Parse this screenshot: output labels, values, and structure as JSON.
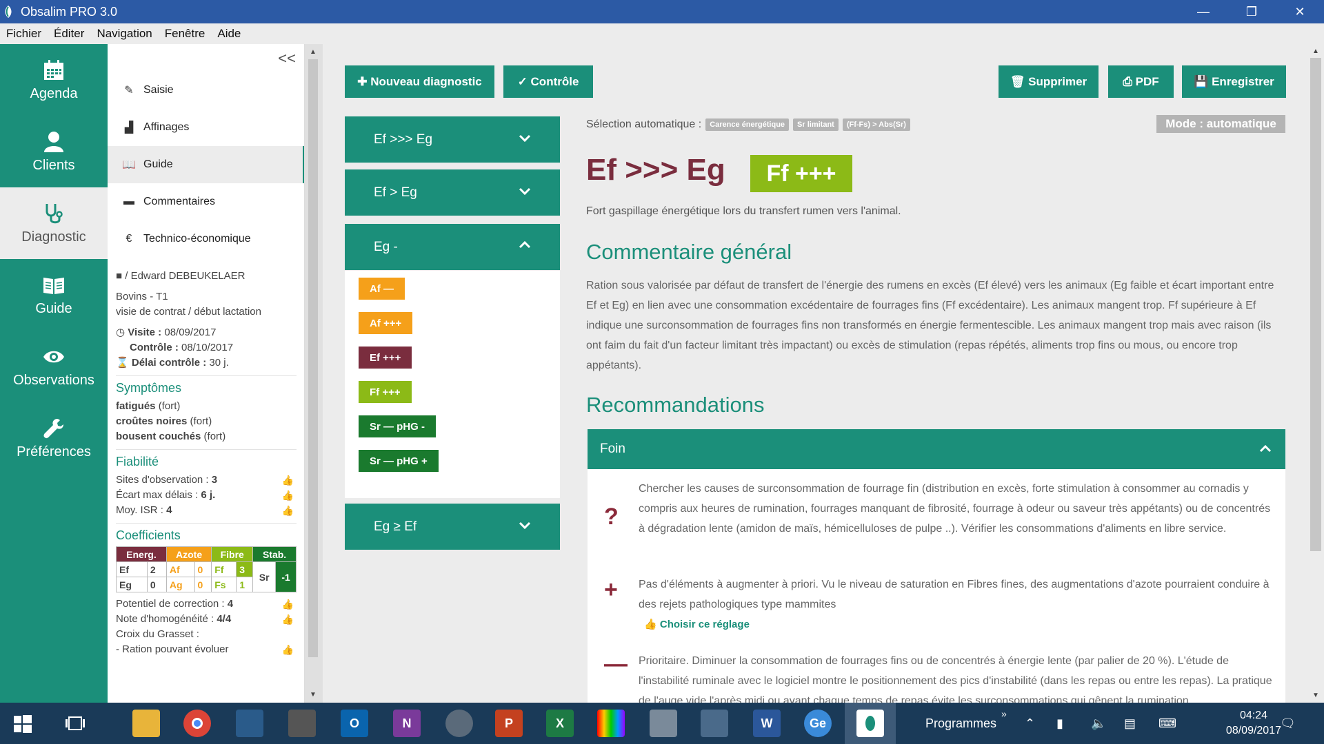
{
  "window": {
    "title": "Obsalim PRO 3.0",
    "minimize": "—",
    "restore": "❐",
    "close": "✕"
  },
  "menu": [
    "Fichier",
    "Éditer",
    "Navigation",
    "Fenêtre",
    "Aide"
  ],
  "mainnav": [
    {
      "label": "Agenda",
      "icon": "calendar-icon"
    },
    {
      "label": "Clients",
      "icon": "user-icon"
    },
    {
      "label": "Diagnostic",
      "icon": "stethoscope-icon",
      "active": true
    },
    {
      "label": "Guide",
      "icon": "book-icon"
    },
    {
      "label": "Observations",
      "icon": "eye-icon"
    },
    {
      "label": "Préférences",
      "icon": "wrench-icon"
    }
  ],
  "subnav": {
    "collapse": "<<",
    "items": [
      {
        "label": "Saisie",
        "icon": "✎"
      },
      {
        "label": "Affinages",
        "icon": "▟"
      },
      {
        "label": "Guide",
        "icon": "📖"
      },
      {
        "label": "Commentaires",
        "icon": "▬"
      },
      {
        "label": "Technico-économique",
        "icon": "€"
      }
    ]
  },
  "client": {
    "name": "/ Edward DEBEUKELAER",
    "herd": "Bovins - T1",
    "visit_type": "visie de contrat / début lactation",
    "visite_label": "Visite :",
    "visite_date": "08/09/2017",
    "controle_label": "Contrôle :",
    "controle_date": "08/10/2017",
    "delai_label": "Délai contrôle :",
    "delai": "30 j."
  },
  "symptomes": {
    "title": "Symptômes",
    "items": [
      {
        "name": "fatigués",
        "level": "(fort)"
      },
      {
        "name": "croûtes noires",
        "level": "(fort)"
      },
      {
        "name": "bousent couchés",
        "level": "(fort)"
      }
    ]
  },
  "fiabilite": {
    "title": "Fiabilité",
    "rows": [
      {
        "label": "Sites d'observation :",
        "value": "3"
      },
      {
        "label": "Écart max délais :",
        "value": "6 j."
      },
      {
        "label": "Moy. ISR :",
        "value": "4"
      }
    ]
  },
  "coefficients": {
    "title": "Coefficients",
    "headers": [
      "Energ.",
      "Azote",
      "Fibre",
      "Stab."
    ],
    "row1": [
      "Ef",
      "2",
      "Af",
      "0",
      "Ff",
      "3"
    ],
    "row2": [
      "Eg",
      "0",
      "Ag",
      "0",
      "Fs",
      "1"
    ],
    "stab": [
      "Sr",
      "-1"
    ],
    "potentiel_label": "Potentiel de correction :",
    "potentiel": "4",
    "homog_label": "Note d'homogénéité :",
    "homog": "4/4",
    "croix_label": "Croix du Grasset :",
    "croix_value": "- Ration pouvant évoluer"
  },
  "toolbar": {
    "nouveau": "Nouveau diagnostic",
    "controle": "Contrôle",
    "supprimer": "Supprimer",
    "pdf": "PDF",
    "enregistrer": "Enregistrer"
  },
  "accordion": [
    {
      "label": "Ef >>> Eg"
    },
    {
      "label": "Ef > Eg"
    },
    {
      "label": "Eg -"
    },
    {
      "label": "Eg ≥ Ef"
    }
  ],
  "tags": [
    {
      "label": "Af —",
      "color": "#f5a01a"
    },
    {
      "label": "Af +++",
      "color": "#f5a01a"
    },
    {
      "label": "Ef +++",
      "color": "#7a2d3e"
    },
    {
      "label": "Ff +++",
      "color": "#8cba17"
    },
    {
      "label": "Sr — pHG -",
      "color": "#1a7a2e"
    },
    {
      "label": "Sr — pHG +",
      "color": "#1a7a2e"
    }
  ],
  "selection": {
    "label": "Sélection automatique :",
    "pills": [
      "Carence énergétique",
      "Sr limitant",
      "(Ff-Fs) > Abs(Sr)"
    ],
    "mode": "Mode : automatique"
  },
  "diagnostic": {
    "title": "Ef >>> Eg",
    "badge": "Ff +++",
    "subtitle": "Fort gaspillage énergétique lors du transfert rumen vers l'animal."
  },
  "commentaire": {
    "title": "Commentaire général",
    "text": "Ration sous valorisée par défaut de transfert de l'énergie des rumens en excès (Ef élevé) vers les animaux (Eg faible et écart important entre Ef et Eg) en lien avec une consommation excédentaire de fourrages fins (Ff excédentaire). Les animaux mangent trop. Ff supérieure à Ef indique une surconsommation de fourrages fins non transformés en énergie fermentescible. Les animaux mangent trop mais avec raison (ils ont faim du fait d'un facteur limitant très impactant) ou excès de stimulation (repas répétés, aliments trop fins ou mous, ou encore trop appétants)."
  },
  "recommandations": {
    "title": "Recommandations",
    "section": "Foin",
    "items": [
      {
        "icon": "?",
        "text": "Chercher les causes de surconsommation de fourrage fin (distribution en excès, forte stimulation à consommer au cornadis y compris aux heures de rumination, fourrages manquant de fibrosité, fourrage à odeur ou saveur très appétants) ou de concentrés à dégradation lente (amidon de maïs, hémicelluloses de pulpe ..). Vérifier les consommations d'aliments en libre service."
      },
      {
        "icon": "+",
        "text": "Pas d'éléments à augmenter à priori. Vu le niveau de saturation en Fibres fines, des augmentations d'azote pourraient conduire à des rejets pathologiques type mammites"
      },
      {
        "icon": "—",
        "text": "Prioritaire. Diminuer la consommation de fourrages fins ou de concentrés à énergie lente (par palier de 20 %). L'étude de l'instabilité ruminale avec le logiciel montre le positionnement des pics d'instabilité (dans les repas ou entre les repas). La pratique de l'auge vide l'après midi ou avant chaque temps de repas évite les surconsommations qui gênent la rumination."
      }
    ],
    "choose": "Choisir ce réglage"
  },
  "taskbar": {
    "programmes": "Programmes",
    "time": "04:24",
    "date": "08/09/2017"
  },
  "colors": {
    "accent": "#1b8f7a",
    "maroon": "#7a2d3e",
    "lime": "#8cba17",
    "orange": "#f5a01a",
    "darkgreen": "#1a7a2e"
  }
}
